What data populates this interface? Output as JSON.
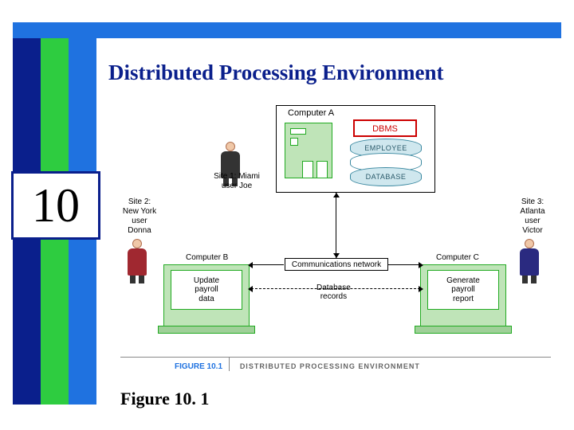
{
  "page": {
    "chapter_number": "10",
    "title": "Distributed Processing Environment",
    "caption": "Figure 10. 1"
  },
  "figure": {
    "caption_num": "FIGURE 10.1",
    "caption_title": "DISTRIBUTED PROCESSING ENVIRONMENT",
    "computer_a": {
      "label": "Computer A",
      "dbms_label": "DBMS",
      "db_top_label": "EMPLOYEE",
      "db_bottom_label": "DATABASE"
    },
    "site1": {
      "label": "Site 1: Miami\nuser Joe"
    },
    "site2": {
      "label": "Site 2:\nNew York\nuser\nDonna"
    },
    "site3": {
      "label": "Site 3:\nAtlanta\nuser\nVictor"
    },
    "computer_b": {
      "label": "Computer B",
      "screen_line1": "Update",
      "screen_line2": "payroll",
      "screen_line3": "data"
    },
    "computer_c": {
      "label": "Computer C",
      "screen_line1": "Generate",
      "screen_line2": "payroll",
      "screen_line3": "report"
    },
    "network": {
      "comm_label": "Communications network",
      "db_records_label": "Database\nrecords"
    }
  }
}
